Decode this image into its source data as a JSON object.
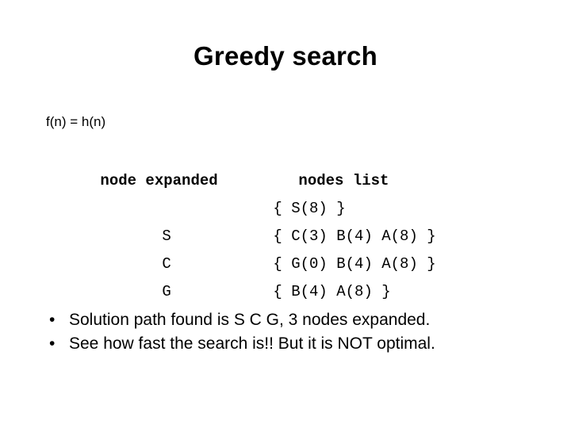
{
  "slide": {
    "title": "Greedy search",
    "formula": "f(n) = h(n)",
    "table": {
      "headers": {
        "node_expanded": "node expanded",
        "nodes_list": "nodes list"
      },
      "rows": [
        {
          "node": "",
          "list": "{ S(8) }"
        },
        {
          "node": "S",
          "list": "{ C(3) B(4) A(8) }"
        },
        {
          "node": "C",
          "list": "{ G(0) B(4) A(8) }"
        },
        {
          "node": "G",
          "list": "{ B(4) A(8) }"
        }
      ]
    },
    "bullets": [
      {
        "marker": "•",
        "text": "Solution path found is S C G, 3 nodes expanded."
      },
      {
        "marker": "•",
        "text": "See how fast the search is!! But it is NOT optimal."
      }
    ]
  }
}
